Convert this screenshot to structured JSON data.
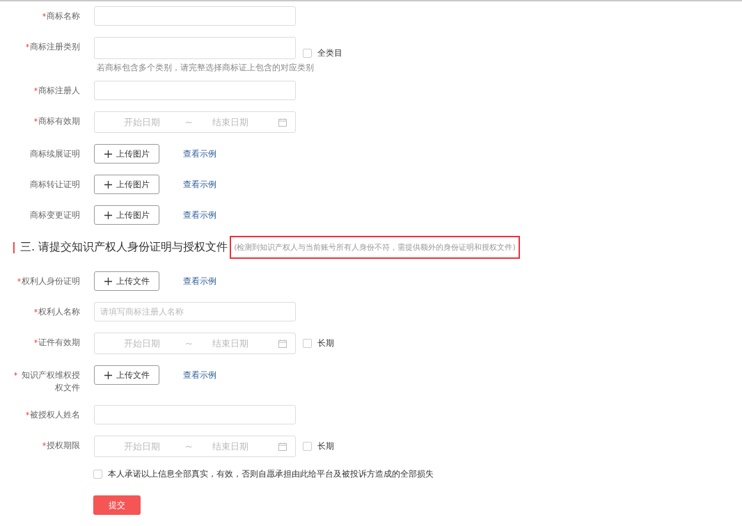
{
  "rows_before": [
    {
      "kind": "text",
      "label": "商标名称",
      "required": true
    },
    {
      "kind": "text",
      "label": "商标注册类别",
      "required": true,
      "checkbox": {
        "label": "全类目",
        "checked": false
      },
      "hint": "若商标包含多个类别，请完整选择商标证上包含的对应类别"
    },
    {
      "kind": "text",
      "label": "商标注册人",
      "required": true
    },
    {
      "kind": "date",
      "label": "商标有效期",
      "required": true,
      "start": "开始日期",
      "sep": "~",
      "end": "结束日期"
    },
    {
      "kind": "upload",
      "label": "商标续展证明",
      "required": false,
      "button": "上传图片",
      "link": "查看示例"
    },
    {
      "kind": "upload",
      "label": "商标转让证明",
      "required": false,
      "button": "上传图片",
      "link": "查看示例"
    },
    {
      "kind": "upload",
      "label": "商标变更证明",
      "required": false,
      "button": "上传图片",
      "link": "查看示例"
    }
  ],
  "section": {
    "title": "三. 请提交知识产权人身份证明与授权文件",
    "note": "(检测到知识产权人与当前账号所有人身份不符，需提供额外的身份证明和授权文件)"
  },
  "rows_after": [
    {
      "kind": "upload",
      "label": "权利人身份证明",
      "required": true,
      "button": "上传文件",
      "link": "查看示例"
    },
    {
      "kind": "text",
      "label": "权利人名称",
      "required": true,
      "placeholder": "请填写商标注册人名称"
    },
    {
      "kind": "date",
      "label": "证件有效期",
      "required": true,
      "start": "开始日期",
      "sep": "~",
      "end": "结束日期",
      "checkbox": {
        "label": "长期",
        "checked": false
      }
    },
    {
      "kind": "upload",
      "label": "知识产权维权授权文件",
      "required": true,
      "button": "上传文件",
      "link": "查看示例"
    },
    {
      "kind": "text",
      "label": "被授权人姓名",
      "required": true
    },
    {
      "kind": "date",
      "label": "授权期限",
      "required": true,
      "start": "开始日期",
      "sep": "~",
      "end": "结束日期",
      "checkbox": {
        "label": "长期",
        "checked": false
      }
    }
  ],
  "agreement": {
    "label": "本人承诺以上信息全部真实，有效，否则自愿承担由此给平台及被投诉方造成的全部损失",
    "checked": false
  },
  "submit": "提交"
}
